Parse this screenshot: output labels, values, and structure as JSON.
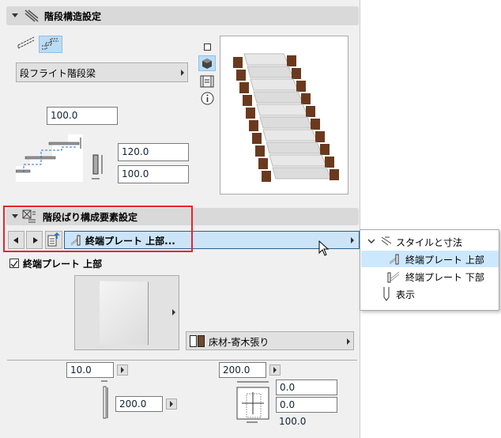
{
  "structure_section": {
    "title": "階段構造設定",
    "type_dropdown": "段フライト階段梁",
    "top_offset": "100.0",
    "beam_height": "120.0",
    "beam_width": "100.0"
  },
  "component_section": {
    "title": "階段ばり構成要素設定",
    "selected_component": "終端プレート 上部...",
    "checkbox_label": "終端プレート 上部",
    "checkbox_checked": true,
    "material": "床材-寄木張り",
    "thickness": "10.0",
    "height": "200.0",
    "width": "200.0",
    "offset_x": "0.0",
    "offset_y": "0.0",
    "bottom_value": "100.0"
  },
  "popup_menu": {
    "group": "スタイルと寸法",
    "items": [
      "終端プレート 上部",
      "終端プレート 下部"
    ],
    "display": "表示",
    "selected_index": 0
  },
  "colors": {
    "accent": "#cce4f7",
    "selection": "#cce8ff",
    "highlight_box": "#e8242b",
    "material_swatch": "#6b4a2e"
  }
}
